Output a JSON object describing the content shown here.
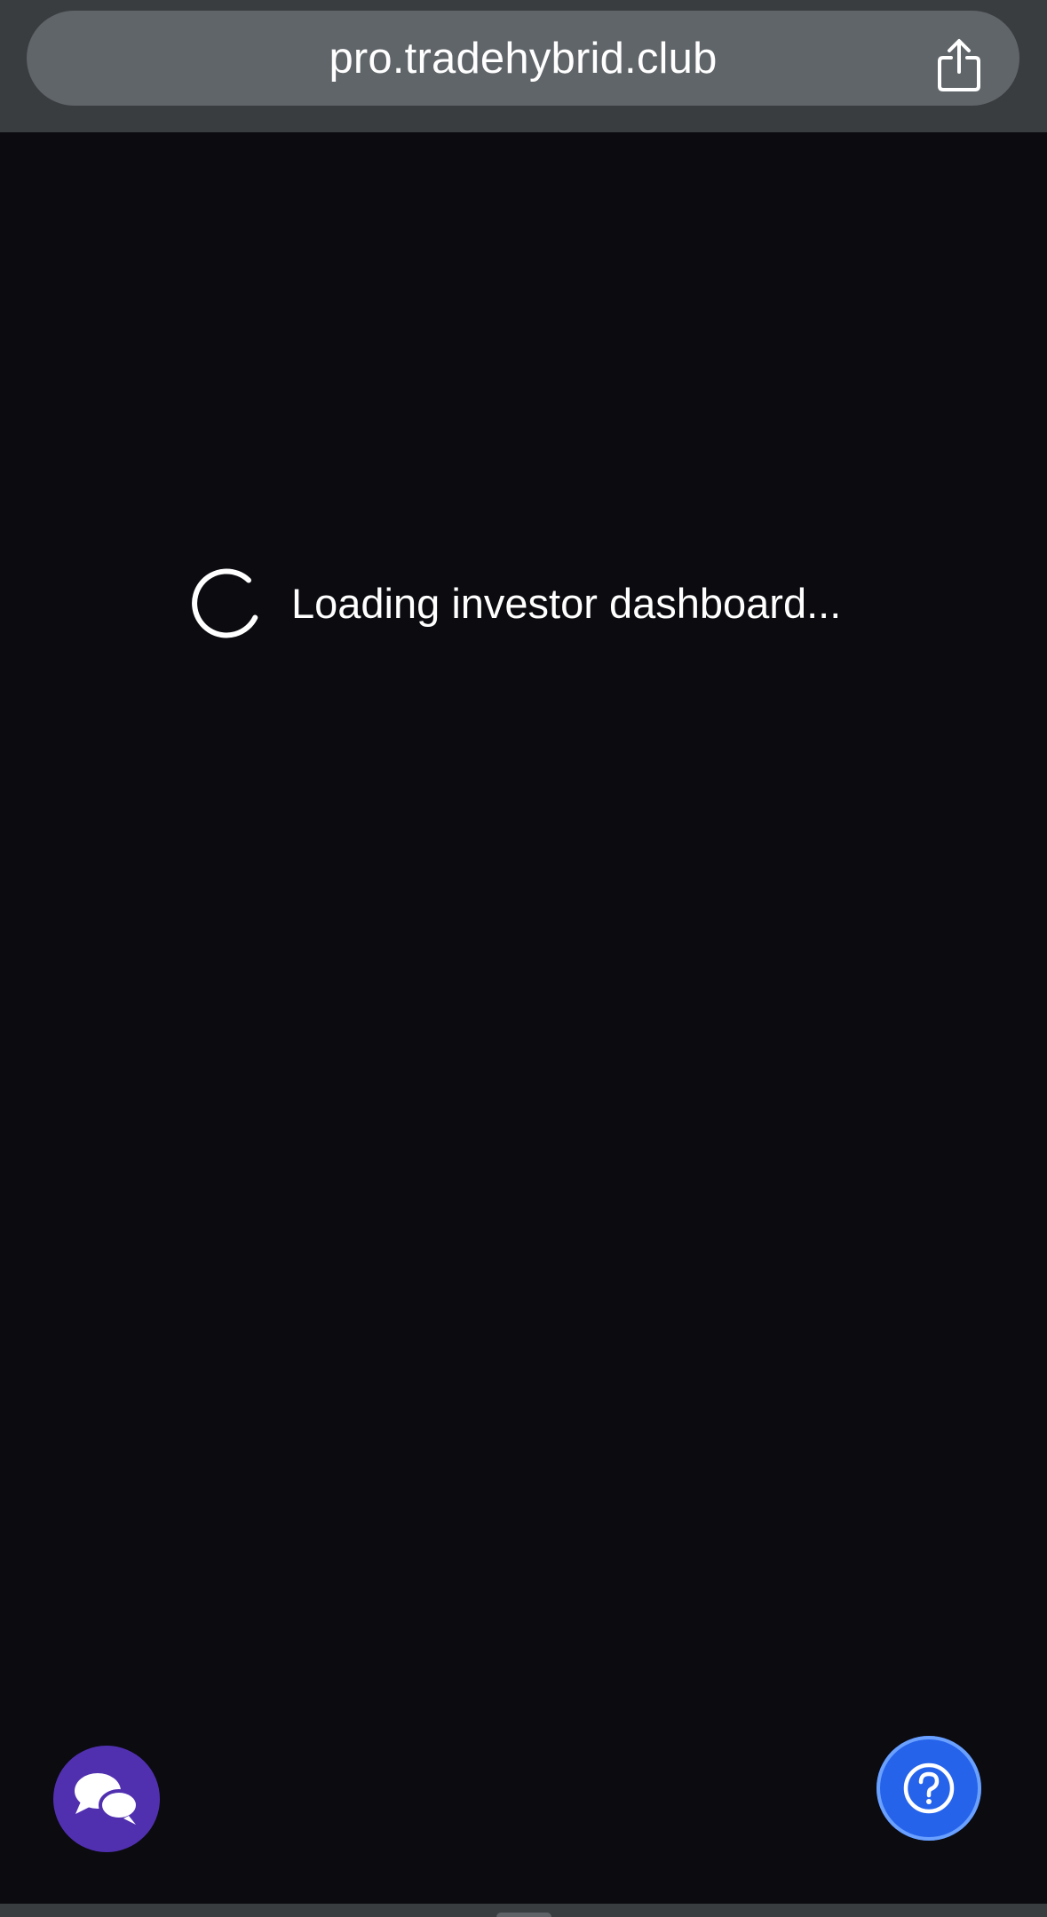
{
  "browser": {
    "url": "pro.tradehybrid.club",
    "share_icon": "share-icon"
  },
  "main": {
    "loading_text": "Loading investor dashboard...",
    "spinner_icon": "loading-spinner-icon"
  },
  "floating": {
    "chat_icon": "chat-bubbles-icon",
    "help_icon": "question-circle-icon",
    "chat_color": "#5130b0",
    "help_color": "#2563eb"
  },
  "colors": {
    "background": "#0b0b10",
    "browser_bar": "#3a3d40",
    "url_pill": "#606569"
  }
}
